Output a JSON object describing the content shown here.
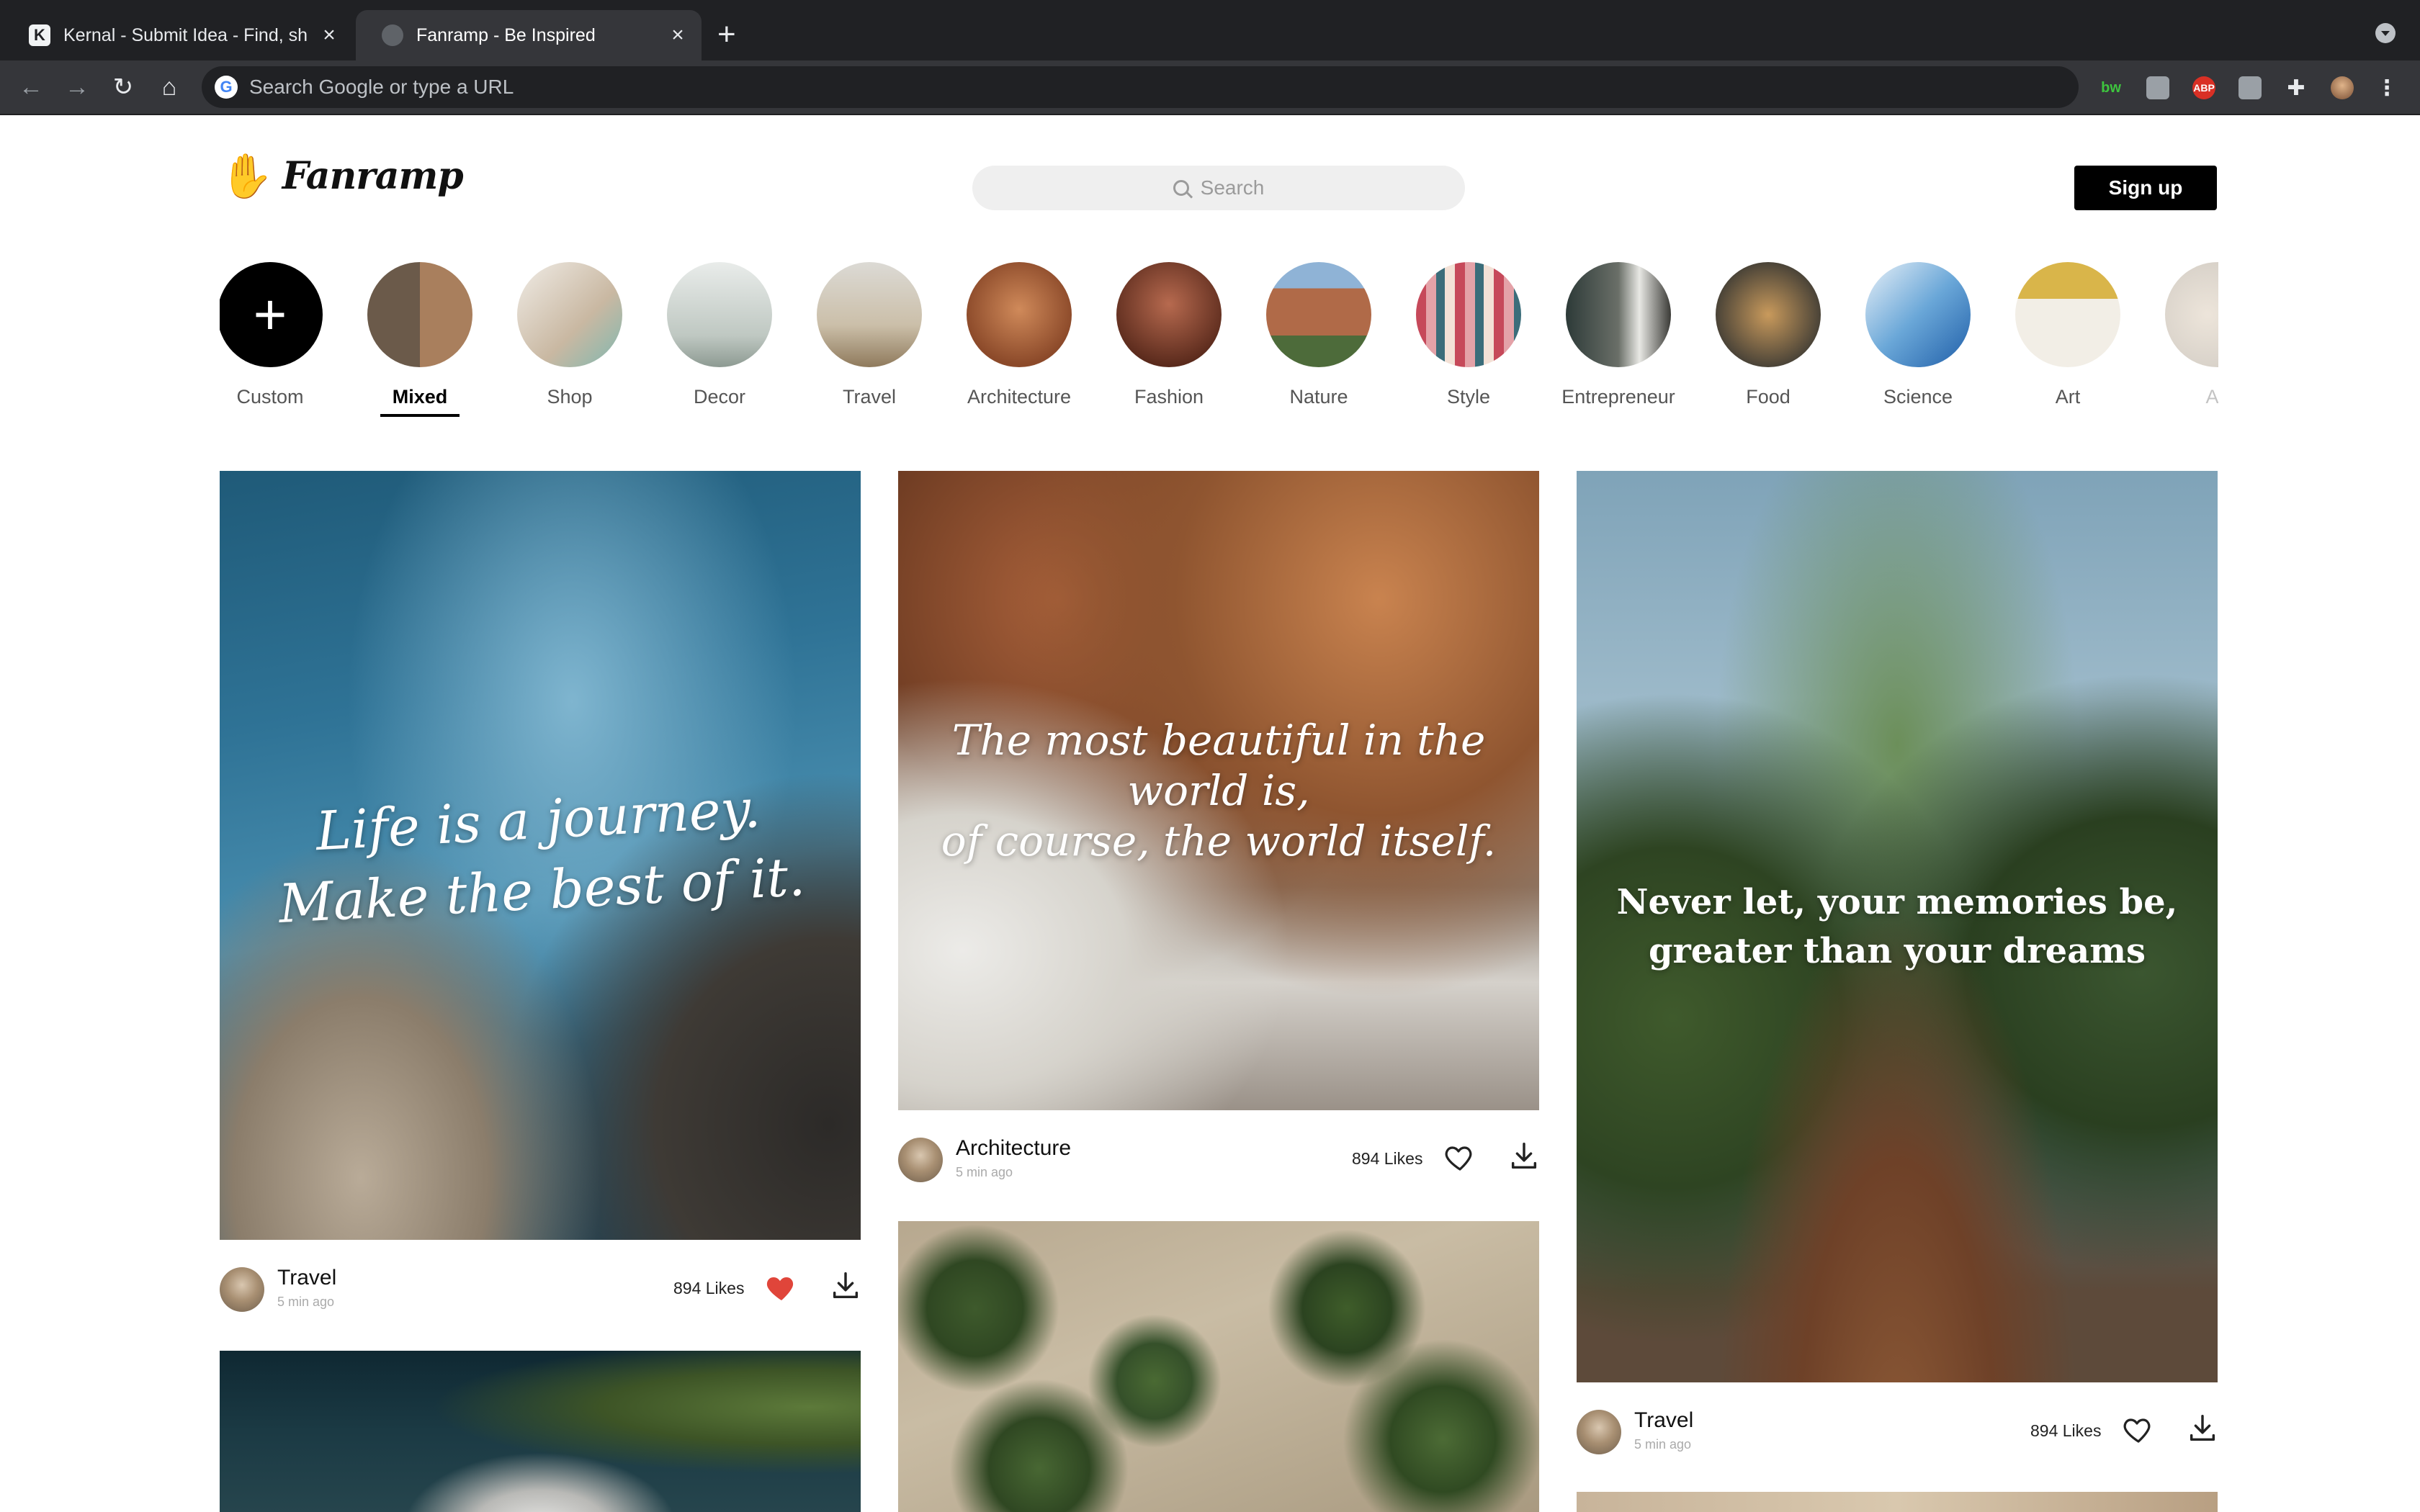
{
  "browser": {
    "tabs": [
      {
        "title": "Kernal - Submit Idea - Find, sh",
        "favicon": "K"
      },
      {
        "title": "Fanramp - Be Inspired"
      }
    ],
    "new_tab": "+",
    "omnibox_placeholder": "Search Google or type a URL",
    "google_letter": "G",
    "extensions": [
      "bw",
      "camera-icon",
      "ABP",
      "pin-icon",
      "puzzle-icon",
      "profile-avatar",
      "more-vert-icon"
    ]
  },
  "header": {
    "logo_text": "Fanramp",
    "search_placeholder": "Search",
    "signup_label": "Sign up"
  },
  "categories": [
    {
      "label": "Custom"
    },
    {
      "label": "Mixed",
      "selected": true
    },
    {
      "label": "Shop"
    },
    {
      "label": "Decor"
    },
    {
      "label": "Travel"
    },
    {
      "label": "Architecture"
    },
    {
      "label": "Fashion"
    },
    {
      "label": "Nature"
    },
    {
      "label": "Style"
    },
    {
      "label": "Entrepreneur"
    },
    {
      "label": "Food"
    },
    {
      "label": "Science"
    },
    {
      "label": "Art"
    },
    {
      "label": "An"
    }
  ],
  "cards": [
    {
      "category": "Travel",
      "time": "5 min ago",
      "likes": "894 Likes",
      "liked": true,
      "quote_line1": "Life is a journey.",
      "quote_line2": "Make the best of it."
    },
    {
      "category": "Architecture",
      "time": "5 min ago",
      "likes": "894 Likes",
      "liked": false,
      "quote_line1": "The most beautiful in the world is,",
      "quote_line2": "of course, the world itself."
    },
    {
      "category": "Travel",
      "time": "5 min ago",
      "likes": "894 Likes",
      "liked": false,
      "quote_line1": "Never let, your memories be,",
      "quote_line2": "greater than your dreams"
    }
  ],
  "colors": {
    "liked_heart": "#e0453a",
    "signup_bg": "#000000"
  }
}
